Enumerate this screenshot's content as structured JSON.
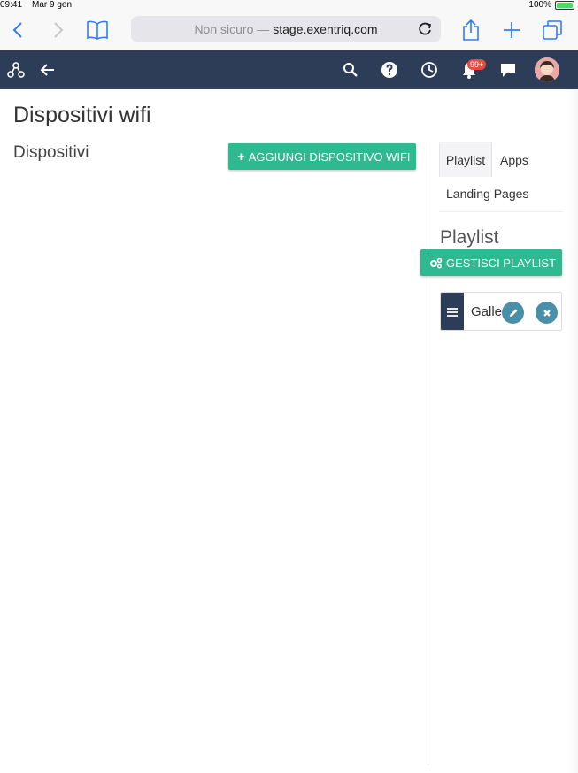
{
  "status_bar": {
    "time": "09:41",
    "date": "Mar 9 gen",
    "battery_pct": "100%",
    "battery_level": 1.0
  },
  "safari": {
    "url_prefix": "Non sicuro —",
    "url_host": "stage.exentriq.com"
  },
  "appbar": {
    "notification_count": "99+"
  },
  "page": {
    "title": "Dispositivi wifi",
    "section_title": "Dispositivi",
    "add_button_label": "AGGIUNGI DISPOSITIVO WIFI"
  },
  "panel": {
    "tabs": [
      "Playlist",
      "Apps",
      "Landing Pages"
    ],
    "playlist_title": "Playlist",
    "manage_button_label": "GESTISCI PLAYLIST",
    "items": [
      {
        "label": "Gallery"
      }
    ]
  },
  "colors": {
    "accent": "#2eb990",
    "header": "#2e3d57",
    "badge": "#e74c3c",
    "action": "#4a8fa8"
  }
}
